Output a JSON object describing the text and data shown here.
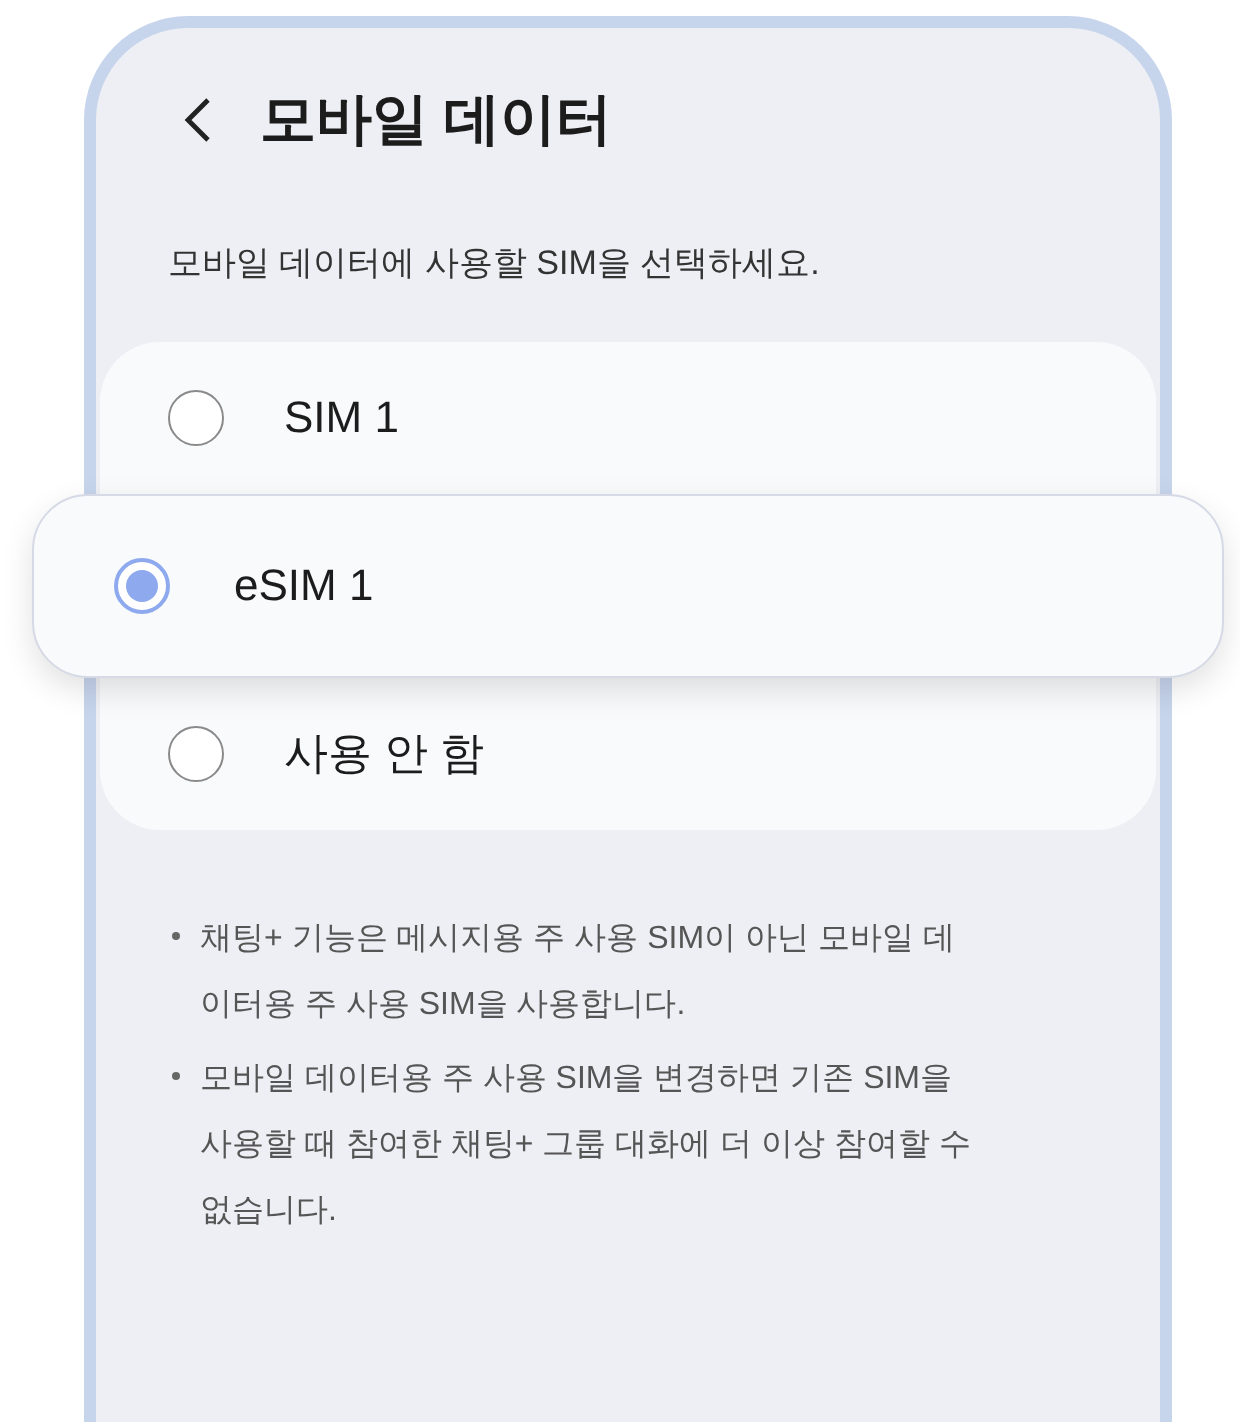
{
  "header": {
    "title": "모바일 데이터"
  },
  "instruction": "모바일 데이터에 사용할 SIM을 선택하세요.",
  "options": [
    {
      "label": "SIM 1",
      "selected": false
    },
    {
      "label": "eSIM 1",
      "selected": true
    },
    {
      "label": "사용 안 함",
      "selected": false
    }
  ],
  "notes": [
    "채팅+ 기능은 메시지용 주 사용 SIM이 아닌 모바일 데이터용 주 사용 SIM을 사용합니다.",
    "모바일 데이터용 주 사용 SIM을 변경하면 기존 SIM을 사용할 때 참여한 채팅+ 그룹 대화에 더 이상 참여할 수 없습니다."
  ]
}
